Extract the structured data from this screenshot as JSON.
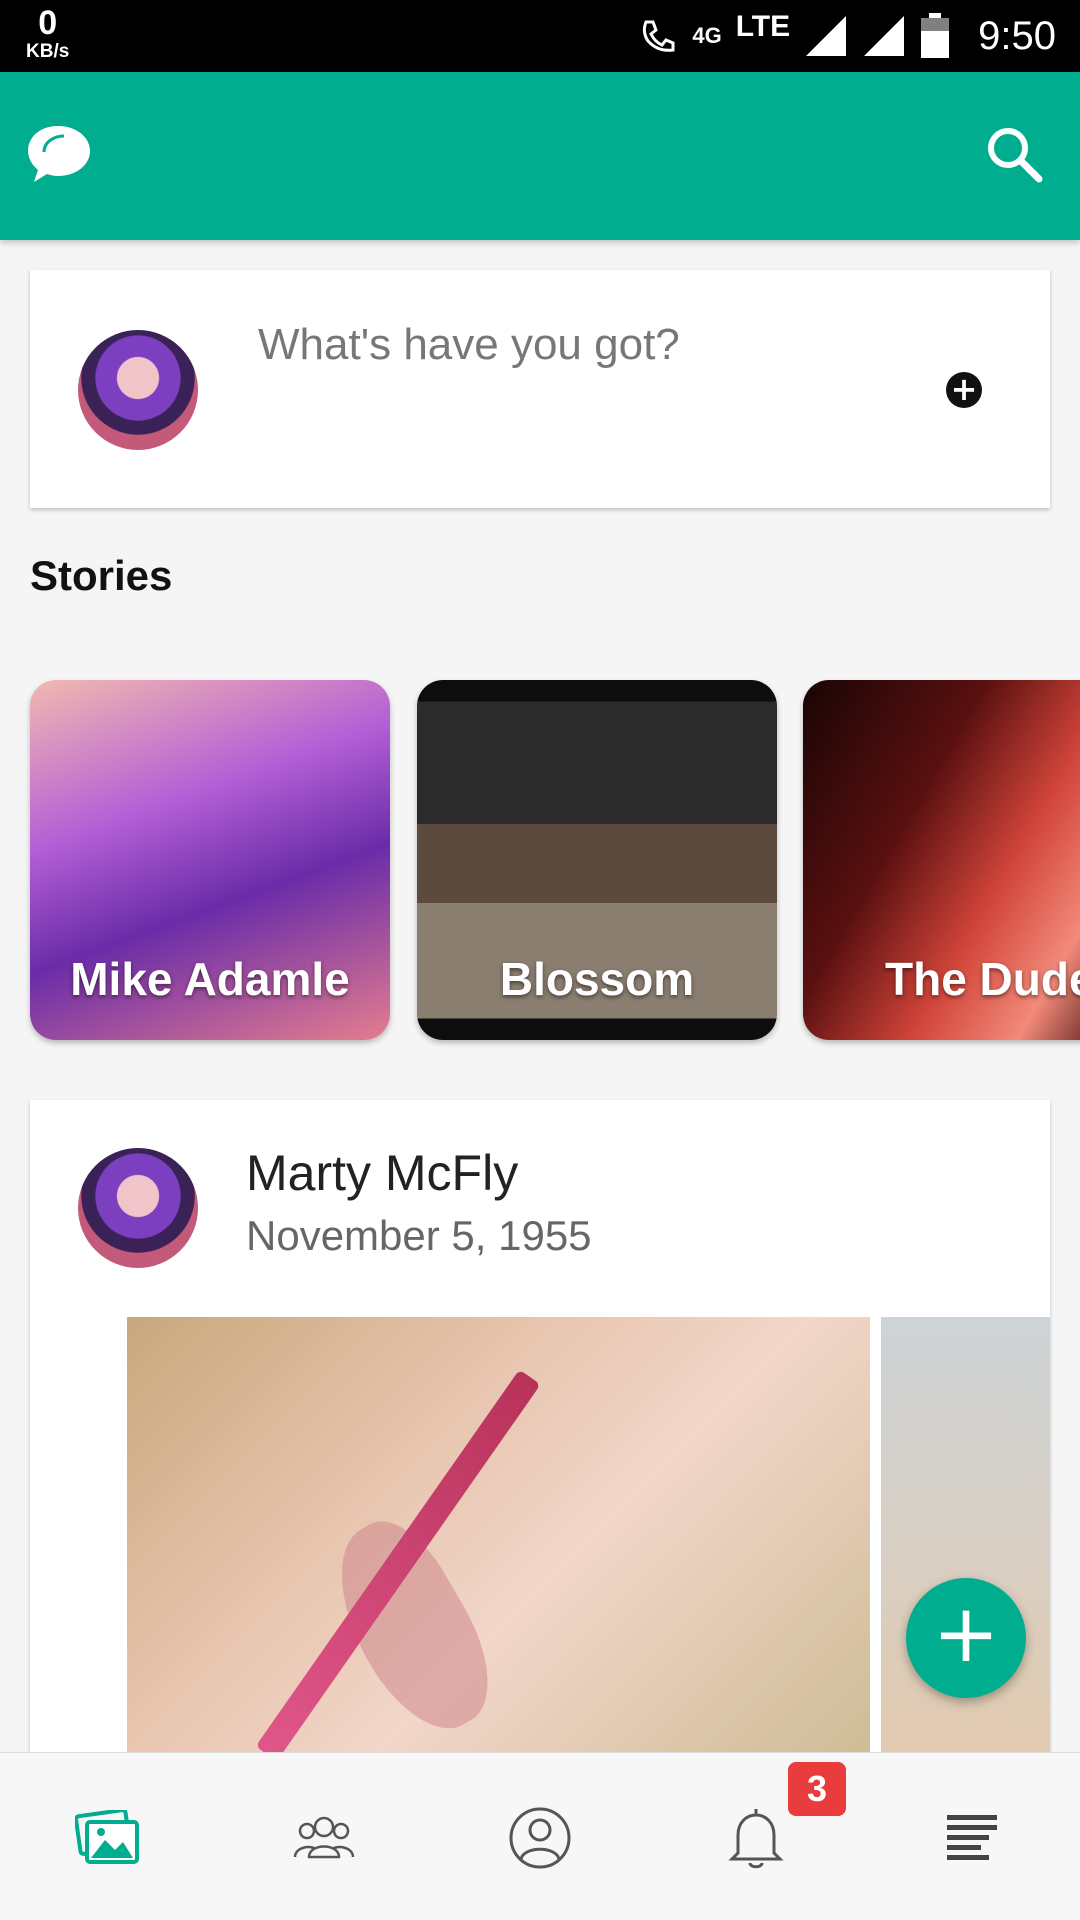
{
  "status_bar": {
    "net_speed": "0",
    "net_unit": "KB/s",
    "net_type": "4G",
    "lte": "LTE",
    "time": "9:50"
  },
  "app_bar": {
    "logo_icon": "chat-bubbles-icon",
    "search_icon": "search-icon",
    "background_color": "#00ad8e"
  },
  "composer": {
    "placeholder": "What's have you got?",
    "add_icon": "plus-circle-icon"
  },
  "stories": {
    "title": "Stories",
    "items": [
      {
        "label": "Mike Adamle"
      },
      {
        "label": "Blossom"
      },
      {
        "label": "The Dude"
      }
    ]
  },
  "post": {
    "author": "Marty McFly",
    "date": "November 5, 1955"
  },
  "fab": {
    "icon": "plus-icon",
    "symbol": "+"
  },
  "bottom_nav": {
    "items": [
      {
        "icon": "gallery-icon",
        "active": true
      },
      {
        "icon": "friends-icon",
        "active": false
      },
      {
        "icon": "profile-icon",
        "active": false
      },
      {
        "icon": "bell-icon",
        "active": false
      },
      {
        "icon": "menu-icon",
        "active": false
      }
    ],
    "notification_count": "3"
  }
}
